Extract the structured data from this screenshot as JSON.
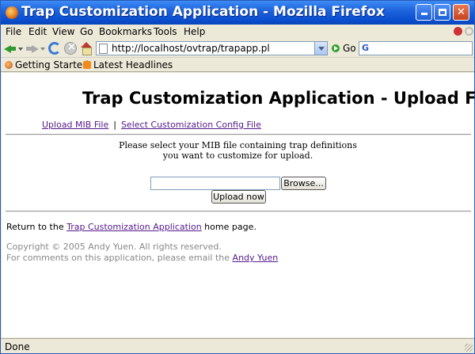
{
  "window": {
    "title": "Trap Customization Application - Mozilla Firefox",
    "controls": {
      "minimize": "",
      "maximize": "",
      "close": "✕"
    }
  },
  "menu": [
    "File",
    "Edit",
    "View",
    "Go",
    "Bookmarks",
    "Tools",
    "Help"
  ],
  "toolbar": {
    "url": "http://localhost/ovtrap/trapapp.pl",
    "go_label": "Go",
    "search_engine_glyph": "G"
  },
  "bookmarks": {
    "items": [
      "Getting Started",
      "Latest Headlines"
    ]
  },
  "page": {
    "title": "Trap Customization Application - Upload File",
    "nav": {
      "upload_mib": "Upload MIB File",
      "separator": "|",
      "select_config": "Select Customization Config File"
    },
    "instructions_line1": "Please select your MIB file containing trap definitions",
    "instructions_line2": "you want to customize for upload.",
    "file_input_value": "",
    "browse_label": "Browse...",
    "upload_label": "Upload now",
    "return": {
      "prefix": "Return to the ",
      "link": "Trap Customization Application",
      "suffix": " home page."
    },
    "copyright": "Copyright © 2005 Andy Yuen. All rights reserved.",
    "comments": {
      "prefix": "For comments on this application, please email the ",
      "link": "Andy Yuen"
    }
  },
  "status": {
    "text": "Done"
  },
  "colors": {
    "titlebar": "#0b4fd0",
    "link_visited": "#551a8b",
    "chrome": "#ece9d8"
  }
}
